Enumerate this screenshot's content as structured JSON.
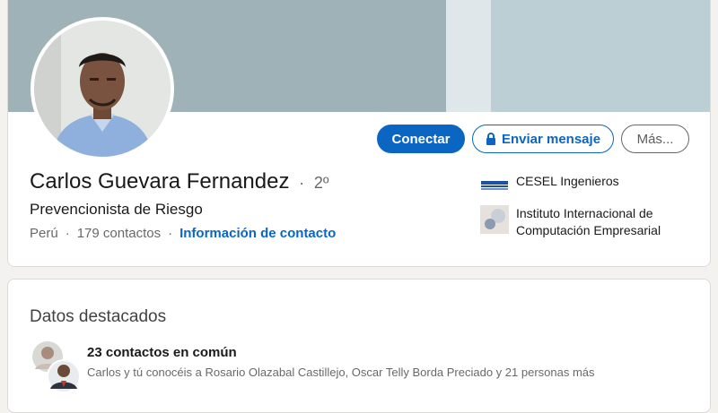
{
  "profile": {
    "name": "Carlos Guevara Fernandez",
    "separator": "·",
    "degree": "2º",
    "headline": "Prevencionista de Riesgo",
    "location": "Perú",
    "dot": "·",
    "connections": "179 contactos",
    "contact_info": "Información de contacto"
  },
  "actions": {
    "connect": "Conectar",
    "message": "Enviar mensaje",
    "more": "Más..."
  },
  "experience": [
    {
      "label": "CESEL Ingenieros"
    },
    {
      "label": "Instituto Internacional de Computación Empresarial"
    }
  ],
  "highlights": {
    "title": "Datos destacados",
    "mutual_count": "23 contactos en común",
    "mutual_detail": "Carlos y tú conocéis a Rosario Olazabal Castillejo, Oscar Telly Borda Preciado y 21 personas más"
  },
  "colors": {
    "primary": "#0a66c2",
    "banner": "#9fb2b8",
    "page_bg": "#f3f2ef"
  }
}
